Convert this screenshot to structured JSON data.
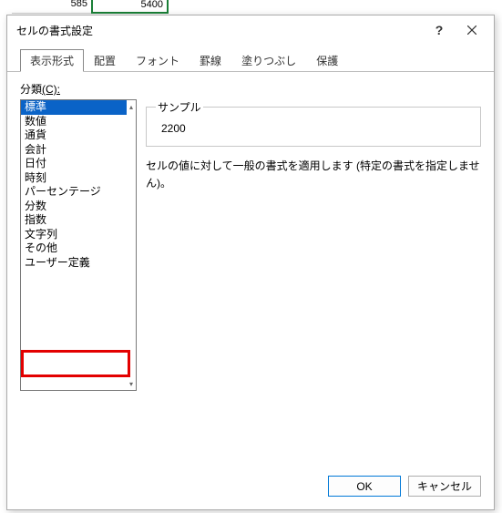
{
  "dialog": {
    "title": "セルの書式設定",
    "help": "?",
    "tabs": [
      "表示形式",
      "配置",
      "フォント",
      "罫線",
      "塗りつぶし",
      "保護"
    ],
    "active_tab_index": 0
  },
  "body": {
    "category_label": "分類",
    "category_label_accel": "(C):",
    "categories": [
      "標準",
      "数値",
      "通貨",
      "会計",
      "日付",
      "時刻",
      "パーセンテージ",
      "分数",
      "指数",
      "文字列",
      "その他",
      "ユーザー定義"
    ],
    "selected_index": 0,
    "highlight_index": 11,
    "sample_label": "サンプル",
    "sample_value": "2200",
    "description": "セルの値に対して一般の書式を適用します (特定の書式を指定しません)。"
  },
  "footer": {
    "ok": "OK",
    "cancel": "キャンセル"
  },
  "bg": {
    "cell_a": "585",
    "cell_b": "5400"
  }
}
